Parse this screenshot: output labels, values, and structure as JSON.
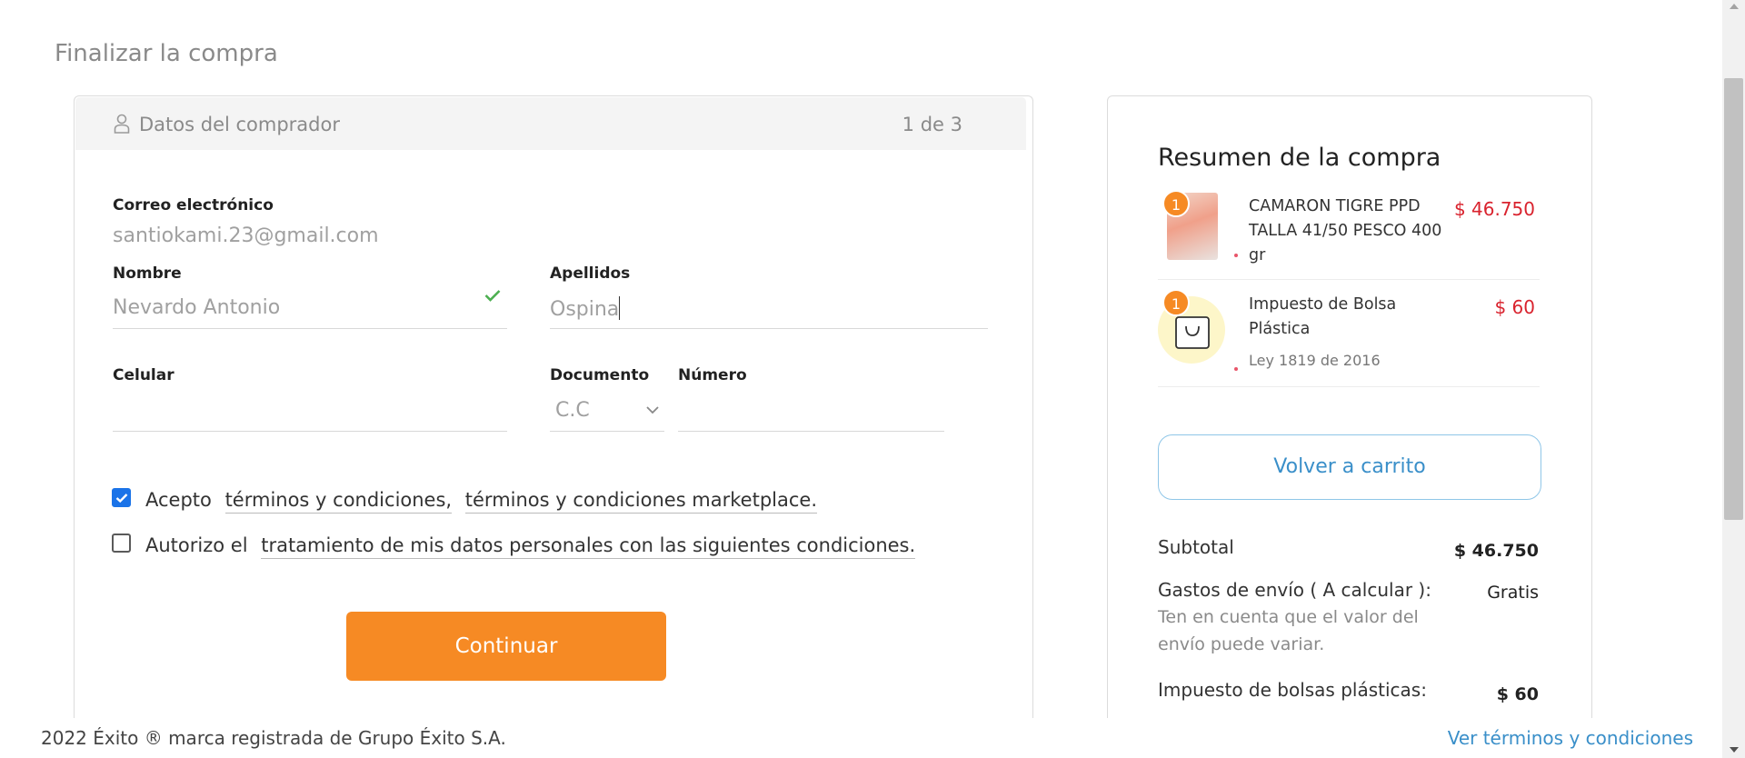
{
  "page": {
    "title": "Finalizar la compra"
  },
  "step": {
    "icon": "user-icon",
    "title": "Datos del comprador",
    "count": "1 de 3"
  },
  "form": {
    "email": {
      "label": "Correo electrónico",
      "value": "santiokami.23@gmail.com"
    },
    "first_name": {
      "label": "Nombre",
      "value": "Nevardo Antonio",
      "valid_icon": "check-icon"
    },
    "last_name": {
      "label": "Apellidos",
      "value": "Ospina"
    },
    "phone": {
      "label": "Celular",
      "value": ""
    },
    "document_type": {
      "label": "Documento",
      "selected": "C.C"
    },
    "document_number": {
      "label": "Número",
      "value": ""
    }
  },
  "consents": {
    "terms": {
      "checked": true,
      "prefix": "Acepto",
      "link1": "términos y condiciones,",
      "link2": "términos y condiciones marketplace."
    },
    "data": {
      "checked": false,
      "prefix": "Autorizo el",
      "link": "tratamiento de mis datos personales con las siguientes condiciones."
    }
  },
  "continue_label": "Continuar",
  "summary": {
    "title": "Resumen de la compra",
    "items": [
      {
        "qty": "1",
        "name": "CAMARON TIGRE PPD TALLA 41/50 PESCO 400 gr",
        "price": "$ 46.750",
        "subtitle": ""
      },
      {
        "qty": "1",
        "name": "Impuesto de Bolsa Plástica",
        "price": "$ 60",
        "subtitle": "Ley 1819 de 2016"
      }
    ],
    "back_to_cart": "Volver a carrito",
    "subtotal": {
      "label": "Subtotal",
      "value": "$ 46.750"
    },
    "shipping": {
      "label": "Gastos de envío ( A calcular ):",
      "value": "Gratis",
      "note": "Ten en cuenta que el valor del envío puede variar."
    },
    "bag_tax": {
      "label": "Impuesto de bolsas plásticas:",
      "value": "$ 60"
    }
  },
  "footer": {
    "copyright": "2022 Éxito ® marca registrada de Grupo Éxito S.A.",
    "terms_link": "Ver términos y condiciones"
  },
  "colors": {
    "accent": "#f68a24",
    "link": "#3a8fc9",
    "price": "#d9232e",
    "checkbox": "#1a73e8"
  }
}
